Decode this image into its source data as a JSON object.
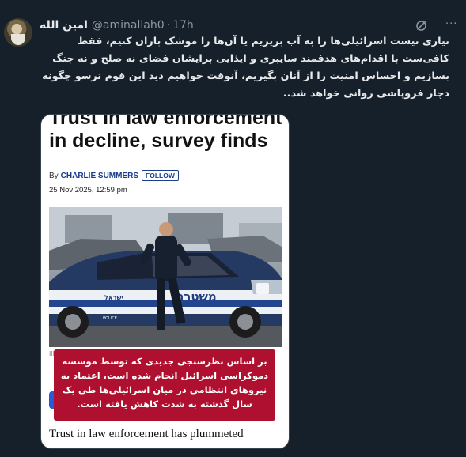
{
  "post": {
    "display_name": "امین الله",
    "handle": "@aminallah0",
    "separator": "·",
    "time": "17h",
    "more_label": "···",
    "text": "نیازی نیست اسرائیلی‌ها را به آب بریزیم یا آن‌ها را موشک باران کنیم، فقط کافی‌ست با اقدام‌های هدفمند سایبری و ایذایی برایشان فضای نه صلح و نه جنگ بسازیم و احساس امنیت را از آنان بگیریم، آنوقت خواهیم دید این قوم ترسو چگونه دچار فروپاشی روانی خواهد شد.."
  },
  "media": {
    "headline": "Trust in law enforcement in decline, survey finds",
    "byline_prefix": "By",
    "author": "CHARLIE SUMMERS",
    "follow_label": "FOLLOW",
    "date": "25 Nov 2025, 12:59 pm",
    "vehicle_text": "משטרה",
    "vehicle_text_small": "ישראל",
    "vehicle_text_tiny": "POLICE",
    "caption_fragment": "Ill",
    "overlay_text": "بر اساس نظرسنجی جدیدی که توسط موسسه دموکراسی اسرائیل انجام شده است، اعتماد به نیروهای انتظامی در میان اسرائیلی‌ها طی یک سال گذشته به شدت کاهش یافته است.",
    "subhead": "Trust in law enforcement has plummeted"
  },
  "colors": {
    "background": "#15202b",
    "text": "#e7e9ea",
    "muted": "#8b98a5",
    "overlay": "#b0102f",
    "author": "#1a3d8f"
  },
  "icons": {
    "grok": "grok-icon",
    "more": "more-icon"
  }
}
